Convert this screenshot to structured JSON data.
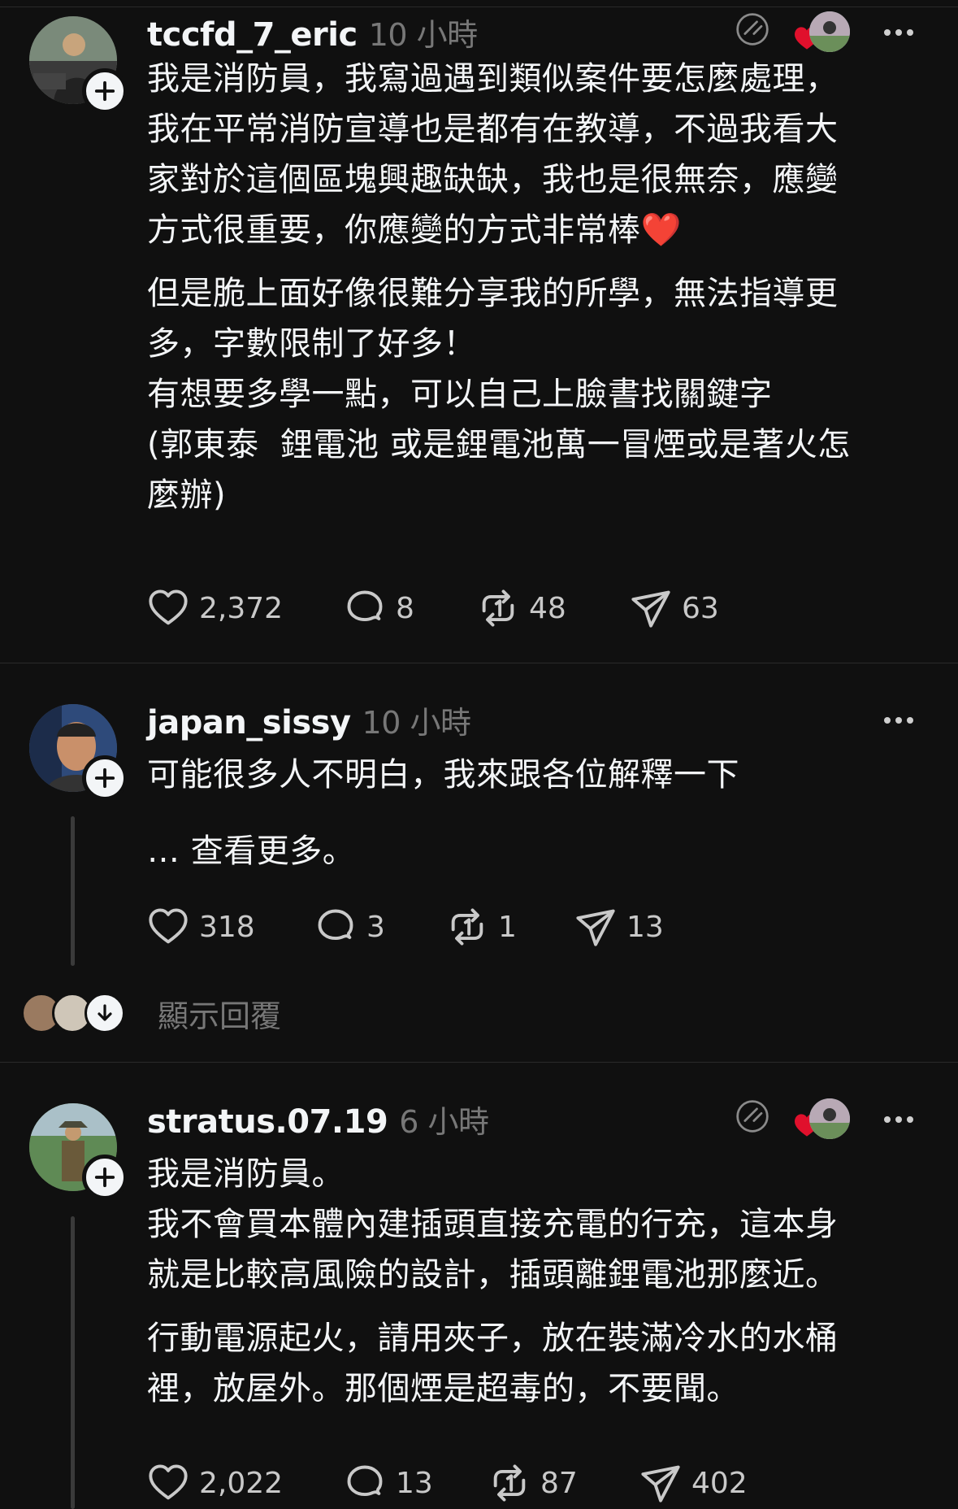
{
  "colors": {
    "background": "#101010",
    "text": "#f3f5f7",
    "muted": "#777777",
    "icon": "#c9c9c9",
    "heart": "#e0102c"
  },
  "posts": [
    {
      "username": "tccfd_7_eric",
      "time": "10 小時",
      "paragraphs": [
        "我是消防員，我寫過遇到類似案件要怎麼處理，\n我在平常消防宣導也是都有在教導，不過我看大\n家對於這個區塊興趣缺缺，我也是很無奈，應變\n方式很重要，你應變的方式非常棒❤️",
        "但是脆上面好像很難分享我的所學，無法指導更\n多，字數限制了好多！\n有想要多學一點，可以自己上臉書找關鍵字\n(郭東泰  鋰電池 或是鋰電池萬一冒煙或是著火怎\n麼辦)"
      ],
      "likes": "2,372",
      "replies": "8",
      "reposts": "48",
      "shares": "63"
    },
    {
      "username": "japan_sissy",
      "time": "10 小時",
      "paragraphs": [
        "可能很多人不明白，我來跟各位解釋一下",
        "… 查看更多。"
      ],
      "likes": "318",
      "replies": "3",
      "reposts": "1",
      "shares": "13",
      "show_replies": "顯示回覆"
    },
    {
      "username": "stratus.07.19",
      "time": "6 小時",
      "paragraphs": [
        "我是消防員。\n我不會買本體內建插頭直接充電的行充，這本身\n就是比較高風險的設計，插頭離鋰電池那麼近。",
        "行動電源起火，請用夾子，放在裝滿冷水的水桶\n裡，放屋外。那個煙是超毒的，不要聞。"
      ],
      "likes": "2,022",
      "replies": "13",
      "reposts": "87",
      "shares": "402"
    }
  ]
}
